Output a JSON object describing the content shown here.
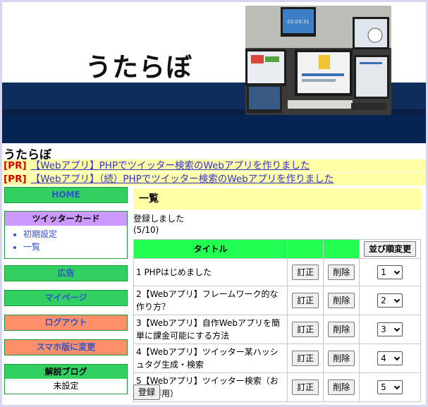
{
  "header": {
    "logo_text": "うたらぼ",
    "photo_clock": "02:03:31"
  },
  "site_title": "うたらぼ",
  "pr_links": [
    {
      "tag": "[PR]",
      "text": "【Webアプリ】PHPでツイッター検索のWebアプリを作りました"
    },
    {
      "tag": "[PR]",
      "text": "【Webアプリ】（続）PHPでツイッター検索のWebアプリを作りました"
    }
  ],
  "sidebar": {
    "home": "HOME",
    "twitter_card": {
      "title": "ツイッターカード",
      "items": [
        "初期設定",
        "一覧"
      ]
    },
    "ads": "広告",
    "mypage": "マイページ",
    "logout": "ログアウト",
    "mobile": "スマホ版に変更",
    "blog": {
      "title": "解説ブログ",
      "value": "未設定"
    }
  },
  "main": {
    "heading": "一覧",
    "message": "登録しました",
    "count": "(5/10)",
    "table": {
      "col_title": "タイトル",
      "sort_button": "並び順変更",
      "edit_label": "訂正",
      "delete_label": "削除",
      "rows": [
        {
          "title": "1 PHPはじめました",
          "order": "1"
        },
        {
          "title": "2【Webアプリ】フレームワーク的な作り方？",
          "order": "2"
        },
        {
          "title": "3【Webアプリ】自作Webアプリを簡単に課金可能にする方法",
          "order": "3"
        },
        {
          "title": "4【Webアプリ】ツイッター某ハッシュタグ生成・検索",
          "order": "4"
        },
        {
          "title": "5【Webアプリ】ツイッター検索（お仕戦専用）",
          "order": "5"
        }
      ]
    },
    "submit_label": "登録"
  },
  "colors": {
    "accent_green": "#31d061",
    "header_green": "#22ff52",
    "accent_orange": "#ff8f6b",
    "pr_yellow": "#ffffa6",
    "navy": "#0e2c5c",
    "link_blue": "#3333cc"
  }
}
